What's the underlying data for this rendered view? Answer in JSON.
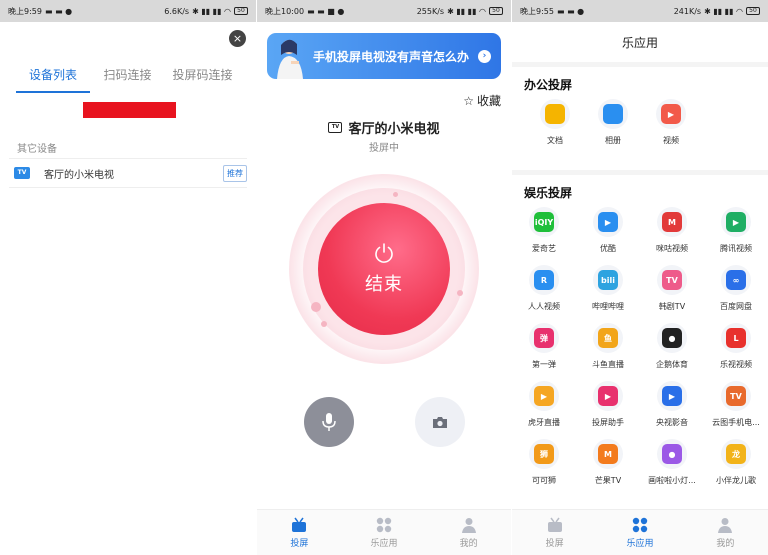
{
  "screen1": {
    "status": {
      "time": "晚上9:59",
      "speed": "6.6K/s",
      "battery": "50"
    },
    "tabs": [
      {
        "label": "设备列表",
        "active": true
      },
      {
        "label": "扫码连接",
        "active": false
      },
      {
        "label": "投屏码连接",
        "active": false
      }
    ],
    "close_icon": "×",
    "section_label": "其它设备",
    "device": {
      "icon": "TV",
      "name": "客厅的小米电视",
      "badge": "推荐"
    }
  },
  "screen2": {
    "status": {
      "time": "晚上10:00",
      "speed": "255K/s",
      "battery": "50"
    },
    "banner_text": "手机投屏电视没有声音怎么办",
    "favorite_label": "收藏",
    "device_icon": "TV",
    "device_name": "客厅的小米电视",
    "cast_status": "投屏中",
    "end_label": "结束",
    "nav": [
      {
        "label": "投屏",
        "active": true
      },
      {
        "label": "乐应用",
        "active": false
      },
      {
        "label": "我的",
        "active": false
      }
    ]
  },
  "screen3": {
    "status": {
      "time": "晚上9:55",
      "speed": "241K/s",
      "battery": "50"
    },
    "title": "乐应用",
    "office_title": "办公投屏",
    "office_apps": [
      {
        "label": "文档",
        "color": "#f5b400",
        "glyph": ""
      },
      {
        "label": "相册",
        "color": "#2a8ff0",
        "glyph": ""
      },
      {
        "label": "视频",
        "color": "#f25a4a",
        "glyph": "▶"
      }
    ],
    "ent_title": "娱乐投屏",
    "ent_apps": [
      {
        "label": "爱奇艺",
        "color": "#1fbf3a",
        "glyph": "iQIY"
      },
      {
        "label": "优酷",
        "color": "#2a8ff0",
        "glyph": "▶"
      },
      {
        "label": "咪咕视频",
        "color": "#e23a3a",
        "glyph": "M"
      },
      {
        "label": "腾讯视频",
        "color": "#1fae64",
        "glyph": "▶"
      },
      {
        "label": "人人视频",
        "color": "#2a8ff0",
        "glyph": "R"
      },
      {
        "label": "哔哩哔哩",
        "color": "#2ea3e0",
        "glyph": "bili"
      },
      {
        "label": "韩剧TV",
        "color": "#ee5b8a",
        "glyph": "TV"
      },
      {
        "label": "百度网盘",
        "color": "#2a6fe8",
        "glyph": "∞"
      },
      {
        "label": "第一弹",
        "color": "#e8316e",
        "glyph": "弹"
      },
      {
        "label": "斗鱼直播",
        "color": "#f2a51a",
        "glyph": "鱼"
      },
      {
        "label": "企鹅体育",
        "color": "#222222",
        "glyph": "●"
      },
      {
        "label": "乐视视频",
        "color": "#e8312d",
        "glyph": "L"
      },
      {
        "label": "虎牙直播",
        "color": "#f5a623",
        "glyph": "▶"
      },
      {
        "label": "投屏助手",
        "color": "#e8316e",
        "glyph": "▶"
      },
      {
        "label": "央视影音",
        "color": "#2a6fe8",
        "glyph": "▶"
      },
      {
        "label": "云图手机电...",
        "color": "#e86a2d",
        "glyph": "TV"
      },
      {
        "label": "可可狮",
        "color": "#f29a1a",
        "glyph": "狮"
      },
      {
        "label": "芒果TV",
        "color": "#f37b1d",
        "glyph": "M"
      },
      {
        "label": "画啦啦小灯...",
        "color": "#9b59e6",
        "glyph": "●"
      },
      {
        "label": "小伴龙儿歌",
        "color": "#f2b31a",
        "glyph": "龙"
      }
    ],
    "nav": [
      {
        "label": "投屏",
        "active": false
      },
      {
        "label": "乐应用",
        "active": true
      },
      {
        "label": "我的",
        "active": false
      }
    ]
  }
}
